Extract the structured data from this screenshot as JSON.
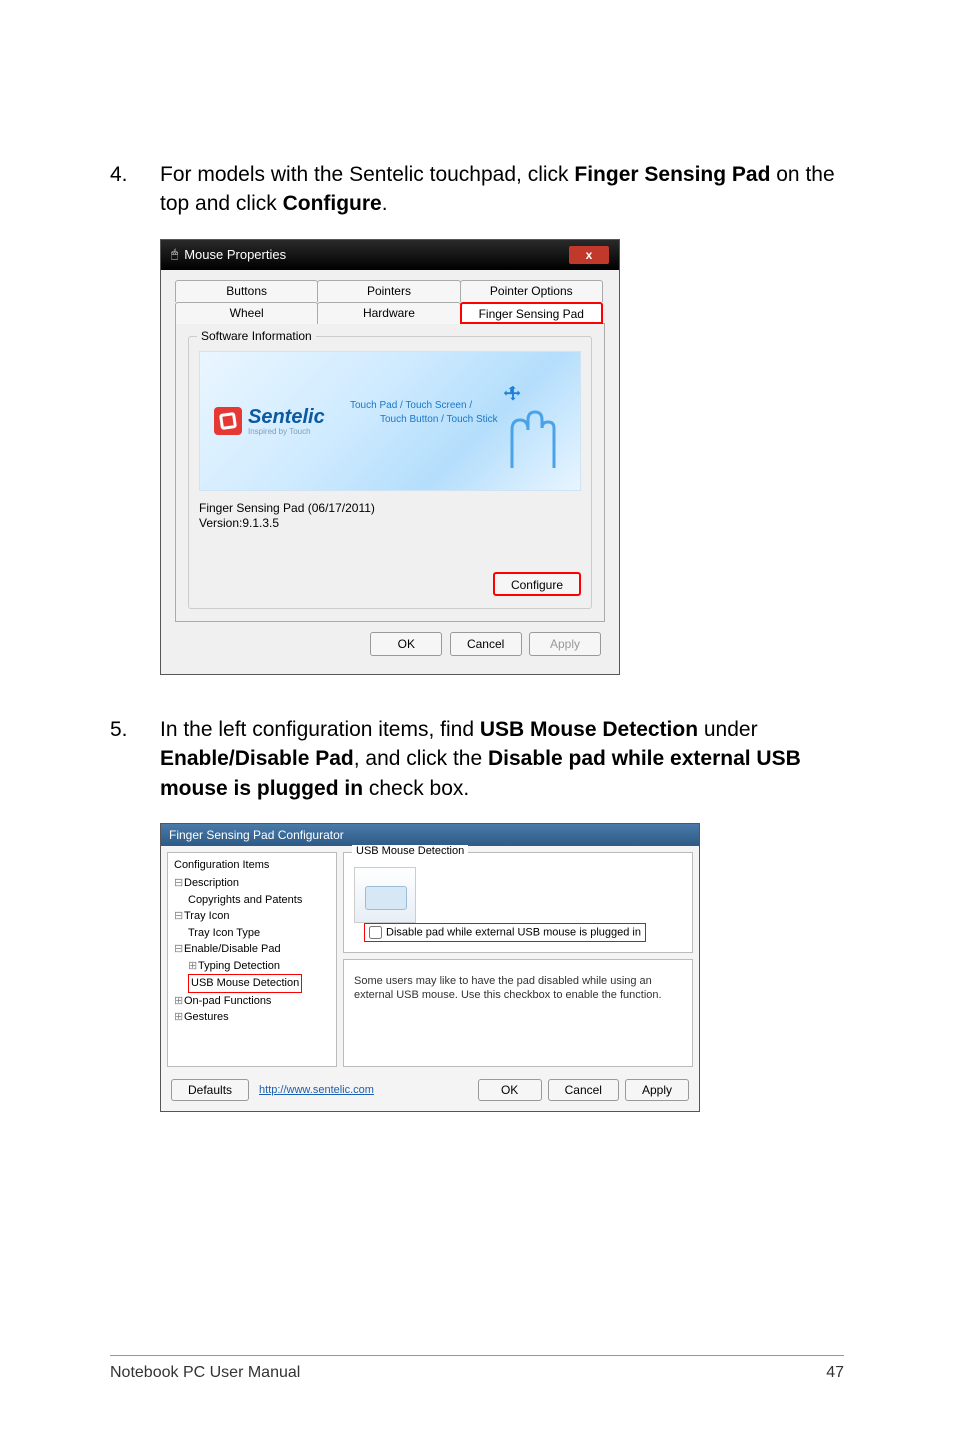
{
  "step4": {
    "num": "4.",
    "text_before_bold1": "For models with the Sentelic touchpad, click ",
    "bold1": "Finger Sensing Pad",
    "text_mid": " on the top and click ",
    "bold2": "Configure",
    "text_after": "."
  },
  "mouse_properties": {
    "title": "Mouse Properties",
    "close": "x",
    "tabs_row1": [
      "Buttons",
      "Pointers",
      "Pointer Options"
    ],
    "tabs_row2": [
      "Wheel",
      "Hardware",
      "Finger Sensing Pad"
    ],
    "group_title": "Software Information",
    "logo_text": "Sentelic",
    "logo_sub": "Inspired by Touch",
    "banner_line1": "Touch Pad / Touch Screen /",
    "banner_line2": "Touch Button / Touch Stick",
    "version_l1": "Finger Sensing Pad (06/17/2011)",
    "version_l2": "Version:9.1.3.5",
    "configure": "Configure",
    "ok": "OK",
    "cancel": "Cancel",
    "apply": "Apply"
  },
  "step5": {
    "num": "5.",
    "t1": "In the left configuration items, find ",
    "b1": "USB Mouse Detection",
    "t2": " under ",
    "b2": "Enable/Disable Pad",
    "t3": ", and click the ",
    "b3": "Disable pad while external USB mouse is plugged in",
    "t4": " check box."
  },
  "configurator": {
    "title": "Finger Sensing Pad Configurator",
    "left_title": "Configuration Items",
    "tree": {
      "description": "Description",
      "copyrights": "Copyrights and Patents",
      "trayicon": "Tray Icon",
      "trayicontype": "Tray Icon Type",
      "enabledisable": "Enable/Disable Pad",
      "typing": "Typing Detection",
      "usbmouse": "USB Mouse Detection",
      "onpad": "On-pad Functions",
      "gestures": "Gestures"
    },
    "right_title": "USB Mouse Detection",
    "checkbox_label": "Disable pad while external USB mouse is plugged in",
    "desc": "Some users may like to have the pad disabled while using an external USB mouse. Use this checkbox to enable the function.",
    "defaults": "Defaults",
    "link": "http://www.sentelic.com",
    "ok": "OK",
    "cancel": "Cancel",
    "apply": "Apply"
  },
  "footer": {
    "left": "Notebook PC User Manual",
    "right": "47"
  }
}
